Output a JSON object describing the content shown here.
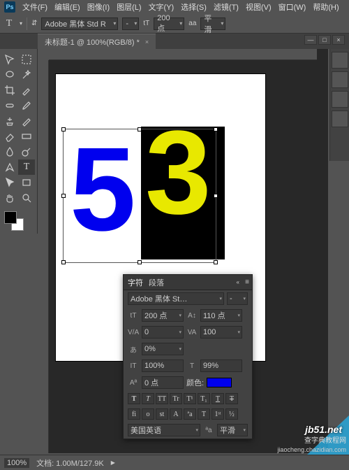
{
  "app": {
    "logo": "Ps"
  },
  "menu": {
    "file": "文件(F)",
    "edit": "编辑(E)",
    "image": "图像(I)",
    "layer": "图层(L)",
    "type": "文字(Y)",
    "select": "选择(S)",
    "filter": "滤镜(T)",
    "view": "视图(V)",
    "window": "窗口(W)",
    "help": "帮助(H)"
  },
  "options": {
    "tool_glyph": "T",
    "orient_glyph": "⇵",
    "font_family": "Adobe 黑体 Std R",
    "font_style": "-",
    "size_icon": "tT",
    "size_value": "200 点",
    "aa_icon": "aa",
    "aa_value": "平滑"
  },
  "doc": {
    "tab_title": "未标题-1 @ 100%(RGB/8) *",
    "close": "×",
    "min": "—",
    "max": "□",
    "x": "×"
  },
  "canvas": {
    "digit_left": "5",
    "digit_right": "3"
  },
  "char_panel": {
    "tab_char": "字符",
    "tab_para": "段落",
    "font_family": "Adobe 黑体 St…",
    "font_style": "-",
    "size_label": "tT",
    "size_value": "200 点",
    "leading_label": "A↕",
    "leading_value": "110 点",
    "va_label": "V/A",
    "va_value": "0",
    "tracking_label": "VA",
    "tracking_value": "100",
    "tsume_label": "あ",
    "tsume_value": "0%",
    "vscale_label": "IT",
    "vscale_value": "100%",
    "hscale_label": "T",
    "hscale_value": "99%",
    "baseline_label": "Aª",
    "baseline_value": "0 点",
    "color_label": "颜色:",
    "style_T": "T",
    "style_Ti": "T",
    "style_TT": "TT",
    "style_Tr": "Tr",
    "style_Tsup": "T¹",
    "style_Tsub": "T₁",
    "style_Tu": "T",
    "style_Ts": "T",
    "ot_fi": "fi",
    "ot_o": "o",
    "ot_st": "st",
    "ot_A": "A",
    "ot_aa": "ªa",
    "ot_T": "T",
    "ot_1st": "1ˢᵗ",
    "ot_half": "½",
    "lang": "美国英语",
    "aa_label": "ªa",
    "aa_value": "平滑"
  },
  "status": {
    "zoom": "100%",
    "doc_label": "文档:",
    "doc_value": "1.00M/127.9K"
  },
  "watermark": {
    "site": "jb51.net",
    "line2": "查字典教程网",
    "line3": "jiaocheng.chazidian.com"
  }
}
